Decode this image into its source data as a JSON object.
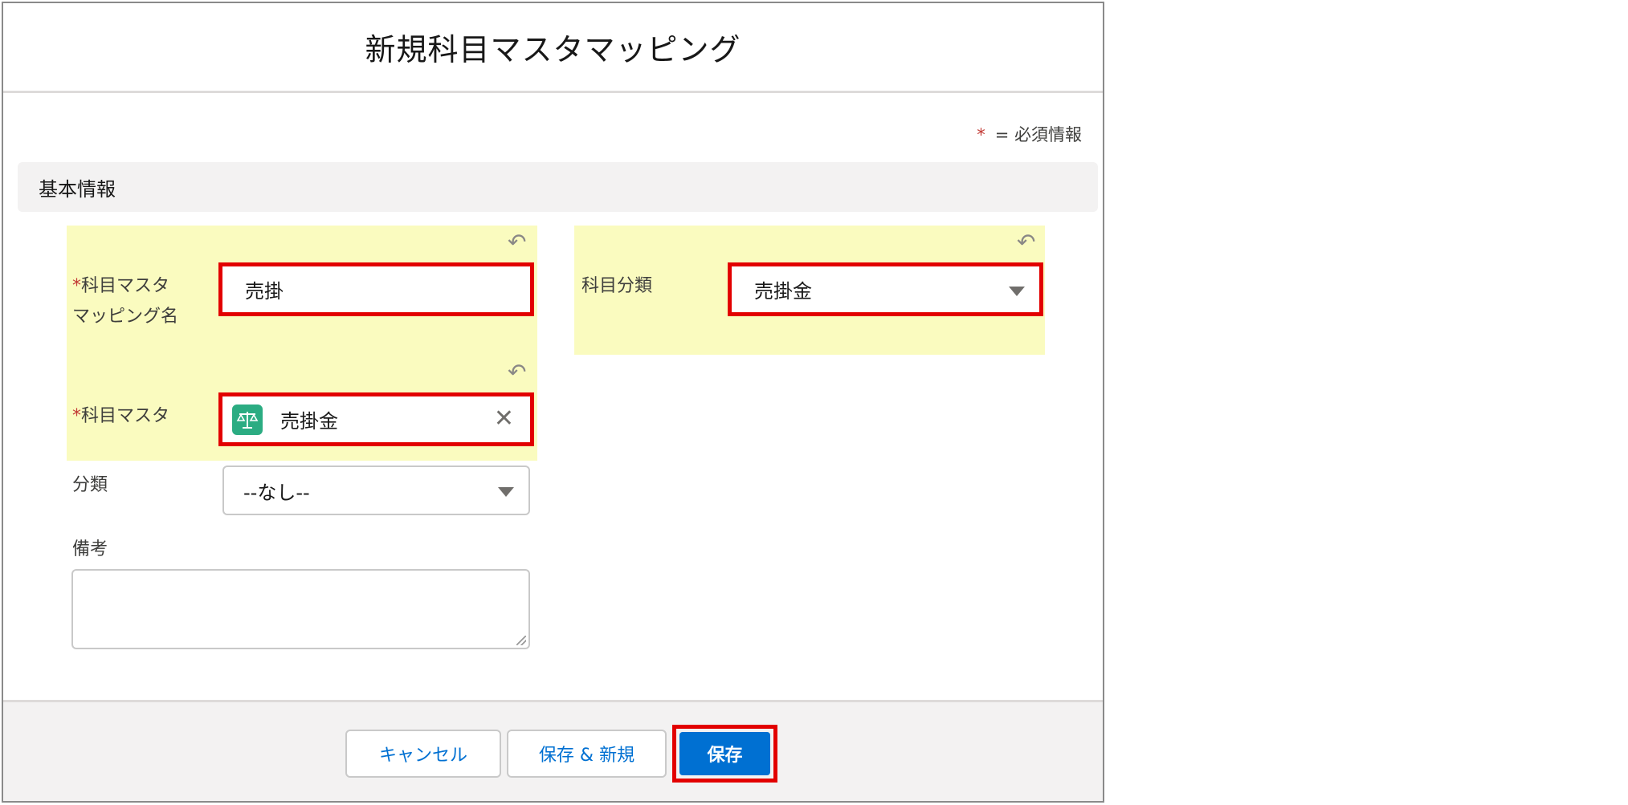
{
  "modal": {
    "title": "新規科目マスタマッピング",
    "required_note": {
      "star": "*",
      "text": "= 必須情報"
    }
  },
  "section": {
    "title": "基本情報"
  },
  "fields": {
    "mapping_name": {
      "required_star": "*",
      "label": "科目マスタマッピング名",
      "value": "売掛"
    },
    "account_master": {
      "required_star": "*",
      "label": "科目マスタ",
      "value": "売掛金",
      "icon": "scale-icon"
    },
    "category": {
      "label": "分類",
      "value": "--なし--"
    },
    "notes": {
      "label": "備考",
      "value": ""
    },
    "account_classification": {
      "label": "科目分類",
      "value": "売掛金"
    }
  },
  "footer": {
    "cancel_label": "キャンセル",
    "save_new_label": "保存 & 新規",
    "save_label": "保存"
  },
  "colors": {
    "highlight": "#fafbbf",
    "annotation_border": "#e20000",
    "primary": "#0070d2",
    "required": "#c23934"
  }
}
